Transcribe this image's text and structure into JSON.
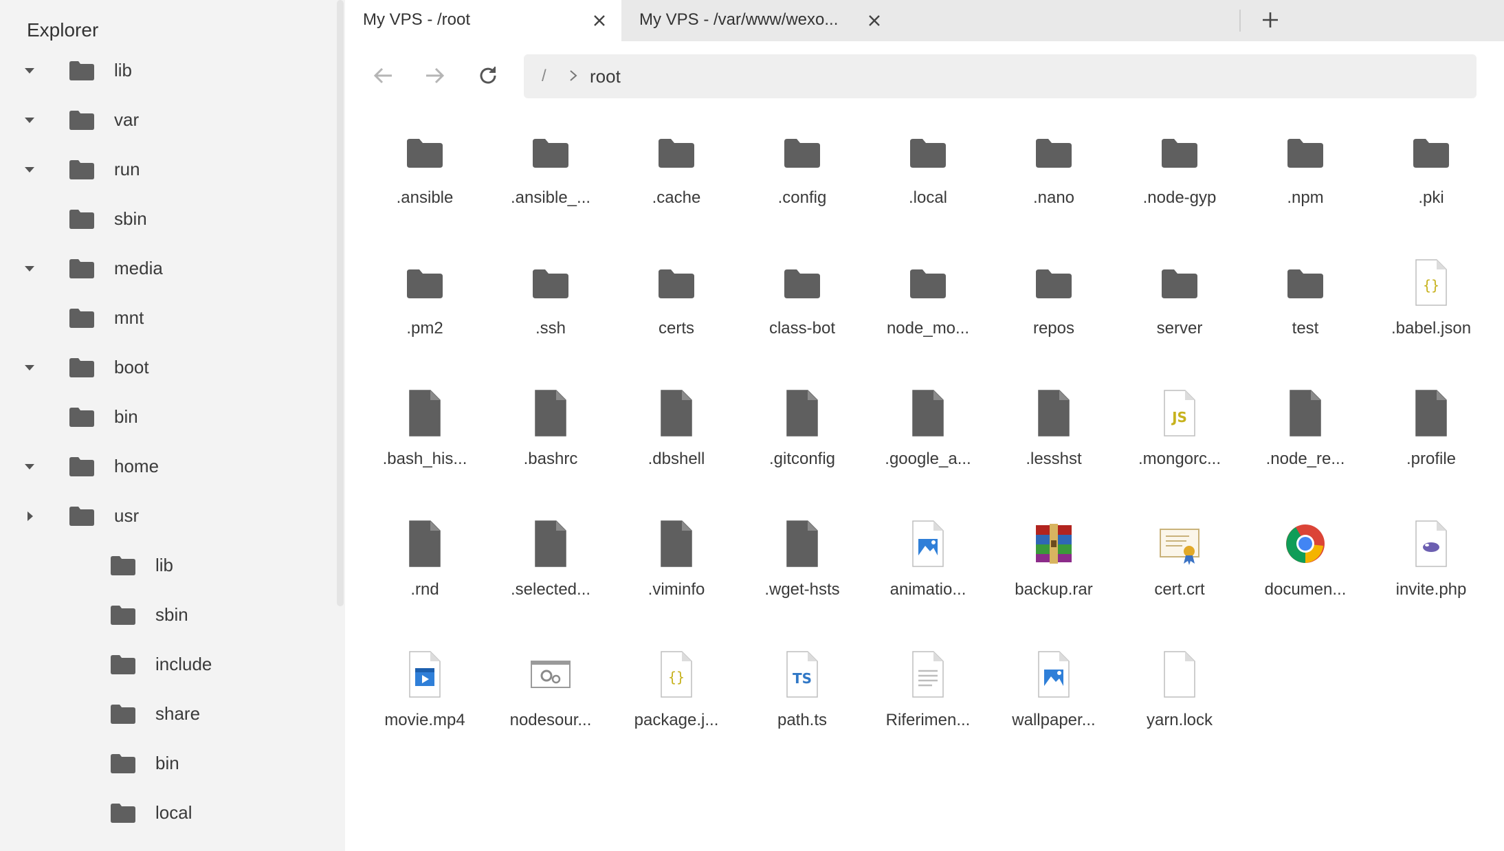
{
  "sidebar": {
    "title": "Explorer",
    "items": [
      {
        "label": "lib",
        "expand": "expanded"
      },
      {
        "label": "var",
        "expand": "expanded"
      },
      {
        "label": "run",
        "expand": "expanded"
      },
      {
        "label": "sbin",
        "expand": "none"
      },
      {
        "label": "media",
        "expand": "expanded"
      },
      {
        "label": "mnt",
        "expand": "none"
      },
      {
        "label": "boot",
        "expand": "expanded"
      },
      {
        "label": "bin",
        "expand": "none"
      },
      {
        "label": "home",
        "expand": "expanded"
      },
      {
        "label": "usr",
        "expand": "collapsed"
      },
      {
        "label": "lib",
        "expand": "none",
        "child": true
      },
      {
        "label": "sbin",
        "expand": "none",
        "child": true
      },
      {
        "label": "include",
        "expand": "none",
        "child": true
      },
      {
        "label": "share",
        "expand": "none",
        "child": true
      },
      {
        "label": "bin",
        "expand": "none",
        "child": true
      },
      {
        "label": "local",
        "expand": "none",
        "child": true
      }
    ]
  },
  "tabs": [
    {
      "label": "My VPS - /root",
      "active": true
    },
    {
      "label": "My VPS - /var/www/wexo...",
      "active": false
    }
  ],
  "nav": {
    "path_root": "/",
    "path_current": "root"
  },
  "files": [
    {
      "name": ".ansible",
      "icon": "folder-icon"
    },
    {
      "name": ".ansible_...",
      "icon": "folder-icon"
    },
    {
      "name": ".cache",
      "icon": "folder-icon"
    },
    {
      "name": ".config",
      "icon": "folder-icon"
    },
    {
      "name": ".local",
      "icon": "folder-icon"
    },
    {
      "name": ".nano",
      "icon": "folder-icon"
    },
    {
      "name": ".node-gyp",
      "icon": "folder-icon"
    },
    {
      "name": ".npm",
      "icon": "folder-icon"
    },
    {
      "name": ".pki",
      "icon": "folder-icon"
    },
    {
      "name": ".pm2",
      "icon": "folder-icon"
    },
    {
      "name": ".ssh",
      "icon": "folder-icon"
    },
    {
      "name": "certs",
      "icon": "folder-icon"
    },
    {
      "name": "class-bot",
      "icon": "folder-icon"
    },
    {
      "name": "node_mo...",
      "icon": "folder-icon"
    },
    {
      "name": "repos",
      "icon": "folder-icon"
    },
    {
      "name": "server",
      "icon": "folder-icon"
    },
    {
      "name": "test",
      "icon": "folder-icon"
    },
    {
      "name": ".babel.json",
      "icon": "json-file-icon"
    },
    {
      "name": ".bash_his...",
      "icon": "file-icon"
    },
    {
      "name": ".bashrc",
      "icon": "file-icon"
    },
    {
      "name": ".dbshell",
      "icon": "file-icon"
    },
    {
      "name": ".gitconfig",
      "icon": "file-icon"
    },
    {
      "name": ".google_a...",
      "icon": "file-icon"
    },
    {
      "name": ".lesshst",
      "icon": "file-icon"
    },
    {
      "name": ".mongorc...",
      "icon": "js-file-icon"
    },
    {
      "name": ".node_re...",
      "icon": "file-icon"
    },
    {
      "name": ".profile",
      "icon": "file-icon"
    },
    {
      "name": ".rnd",
      "icon": "file-icon"
    },
    {
      "name": ".selected...",
      "icon": "file-icon"
    },
    {
      "name": ".viminfo",
      "icon": "file-icon"
    },
    {
      "name": ".wget-hsts",
      "icon": "file-icon"
    },
    {
      "name": "animatio...",
      "icon": "image-file-icon"
    },
    {
      "name": "backup.rar",
      "icon": "rar-archive-icon"
    },
    {
      "name": "cert.crt",
      "icon": "certificate-icon"
    },
    {
      "name": "documen...",
      "icon": "chrome-icon"
    },
    {
      "name": "invite.php",
      "icon": "php-file-icon"
    },
    {
      "name": "movie.mp4",
      "icon": "video-file-icon"
    },
    {
      "name": "nodesour...",
      "icon": "settings-file-icon"
    },
    {
      "name": "package.j...",
      "icon": "json-file-icon"
    },
    {
      "name": "path.ts",
      "icon": "ts-file-icon"
    },
    {
      "name": "Riferimen...",
      "icon": "text-file-icon"
    },
    {
      "name": "wallpaper...",
      "icon": "image-file-icon"
    },
    {
      "name": "yarn.lock",
      "icon": "blank-file-icon"
    }
  ],
  "colors": {
    "sidebar_bg": "#f3f3f3",
    "tabbar_bg": "#e9e9e9",
    "icon_gray": "#5f5f5f"
  }
}
